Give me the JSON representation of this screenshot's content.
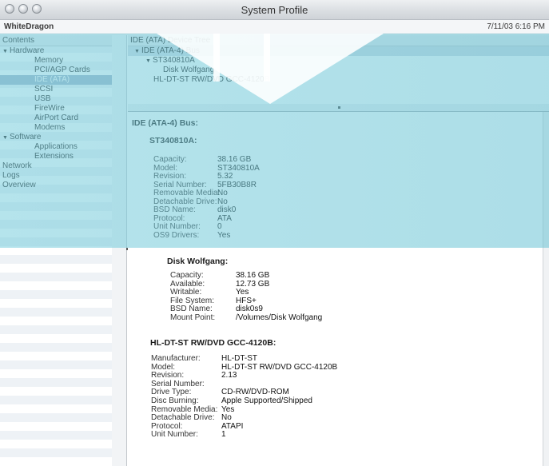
{
  "window": {
    "title": "System Profile"
  },
  "info": {
    "machine_name": "WhiteDragon",
    "datetime": "7/11/03 6:16 PM"
  },
  "sidebar": {
    "header": "Contents",
    "items": [
      {
        "label": "Hardware",
        "level": "cat"
      },
      {
        "label": "Memory",
        "level": "sub"
      },
      {
        "label": "PCI/AGP Cards",
        "level": "sub"
      },
      {
        "label": "IDE (ATA)",
        "level": "sub",
        "selected": true
      },
      {
        "label": "SCSI",
        "level": "sub"
      },
      {
        "label": "USB",
        "level": "sub"
      },
      {
        "label": "FireWire",
        "level": "sub"
      },
      {
        "label": "AirPort Card",
        "level": "sub"
      },
      {
        "label": "Modems",
        "level": "sub"
      },
      {
        "label": "Software",
        "level": "cat"
      },
      {
        "label": "Applications",
        "level": "sub"
      },
      {
        "label": "Extensions",
        "level": "sub"
      },
      {
        "label": "Network",
        "level": "top"
      },
      {
        "label": "Logs",
        "level": "top"
      },
      {
        "label": "Overview",
        "level": "top"
      }
    ]
  },
  "tree": {
    "header": "IDE (ATA) Device Tree",
    "rows": [
      {
        "label": "IDE (ATA-4) Bus",
        "indent": "ind0",
        "expanded": true
      },
      {
        "label": "ST340810A",
        "indent": "ind1",
        "expanded": true
      },
      {
        "label": "Disk Wolfgang",
        "indent": "ind2"
      },
      {
        "label": "HL-DT-ST RW/DVD GCC-4120B",
        "indent": "ind2b"
      }
    ]
  },
  "detail": {
    "bus_title": "IDE (ATA-4) Bus:",
    "drive1": {
      "title": "ST340810A:",
      "fields": [
        {
          "k": "Capacity:",
          "v": "38.16 GB"
        },
        {
          "k": "Model:",
          "v": "ST340810A"
        },
        {
          "k": "Revision:",
          "v": "5.32"
        },
        {
          "k": "Serial Number:",
          "v": "5FB30B8R"
        },
        {
          "k": "Removable Media:",
          "v": "No"
        },
        {
          "k": "Detachable Drive:",
          "v": "No"
        },
        {
          "k": "BSD Name:",
          "v": "disk0"
        },
        {
          "k": "Protocol:",
          "v": "ATA"
        },
        {
          "k": "Unit Number:",
          "v": "0"
        },
        {
          "k": "OS9 Drivers:",
          "v": "Yes"
        }
      ]
    },
    "volume": {
      "title": "Disk Wolfgang:",
      "fields": [
        {
          "k": "Capacity:",
          "v": "38.16 GB"
        },
        {
          "k": "Available:",
          "v": "12.73 GB"
        },
        {
          "k": "Writable:",
          "v": "Yes"
        },
        {
          "k": "File System:",
          "v": "HFS+"
        },
        {
          "k": "BSD Name:",
          "v": "disk0s9"
        },
        {
          "k": "Mount Point:",
          "v": "/Volumes/Disk Wolfgang"
        }
      ]
    },
    "drive2": {
      "title": "HL-DT-ST RW/DVD GCC-4120B:",
      "fields": [
        {
          "k": "Manufacturer:",
          "v": "HL-DT-ST"
        },
        {
          "k": "Model:",
          "v": "HL-DT-ST RW/DVD GCC-4120B"
        },
        {
          "k": "Revision:",
          "v": "2.13"
        },
        {
          "k": "Serial Number:",
          "v": ""
        },
        {
          "k": "Drive Type:",
          "v": "CD-RW/DVD-ROM"
        },
        {
          "k": "Disc Burning:",
          "v": "Apple Supported/Shipped"
        },
        {
          "k": "Removable Media:",
          "v": "Yes"
        },
        {
          "k": "Detachable Drive:",
          "v": "No"
        },
        {
          "k": "Protocol:",
          "v": "ATAPI"
        },
        {
          "k": "Unit Number:",
          "v": "1"
        }
      ]
    }
  }
}
